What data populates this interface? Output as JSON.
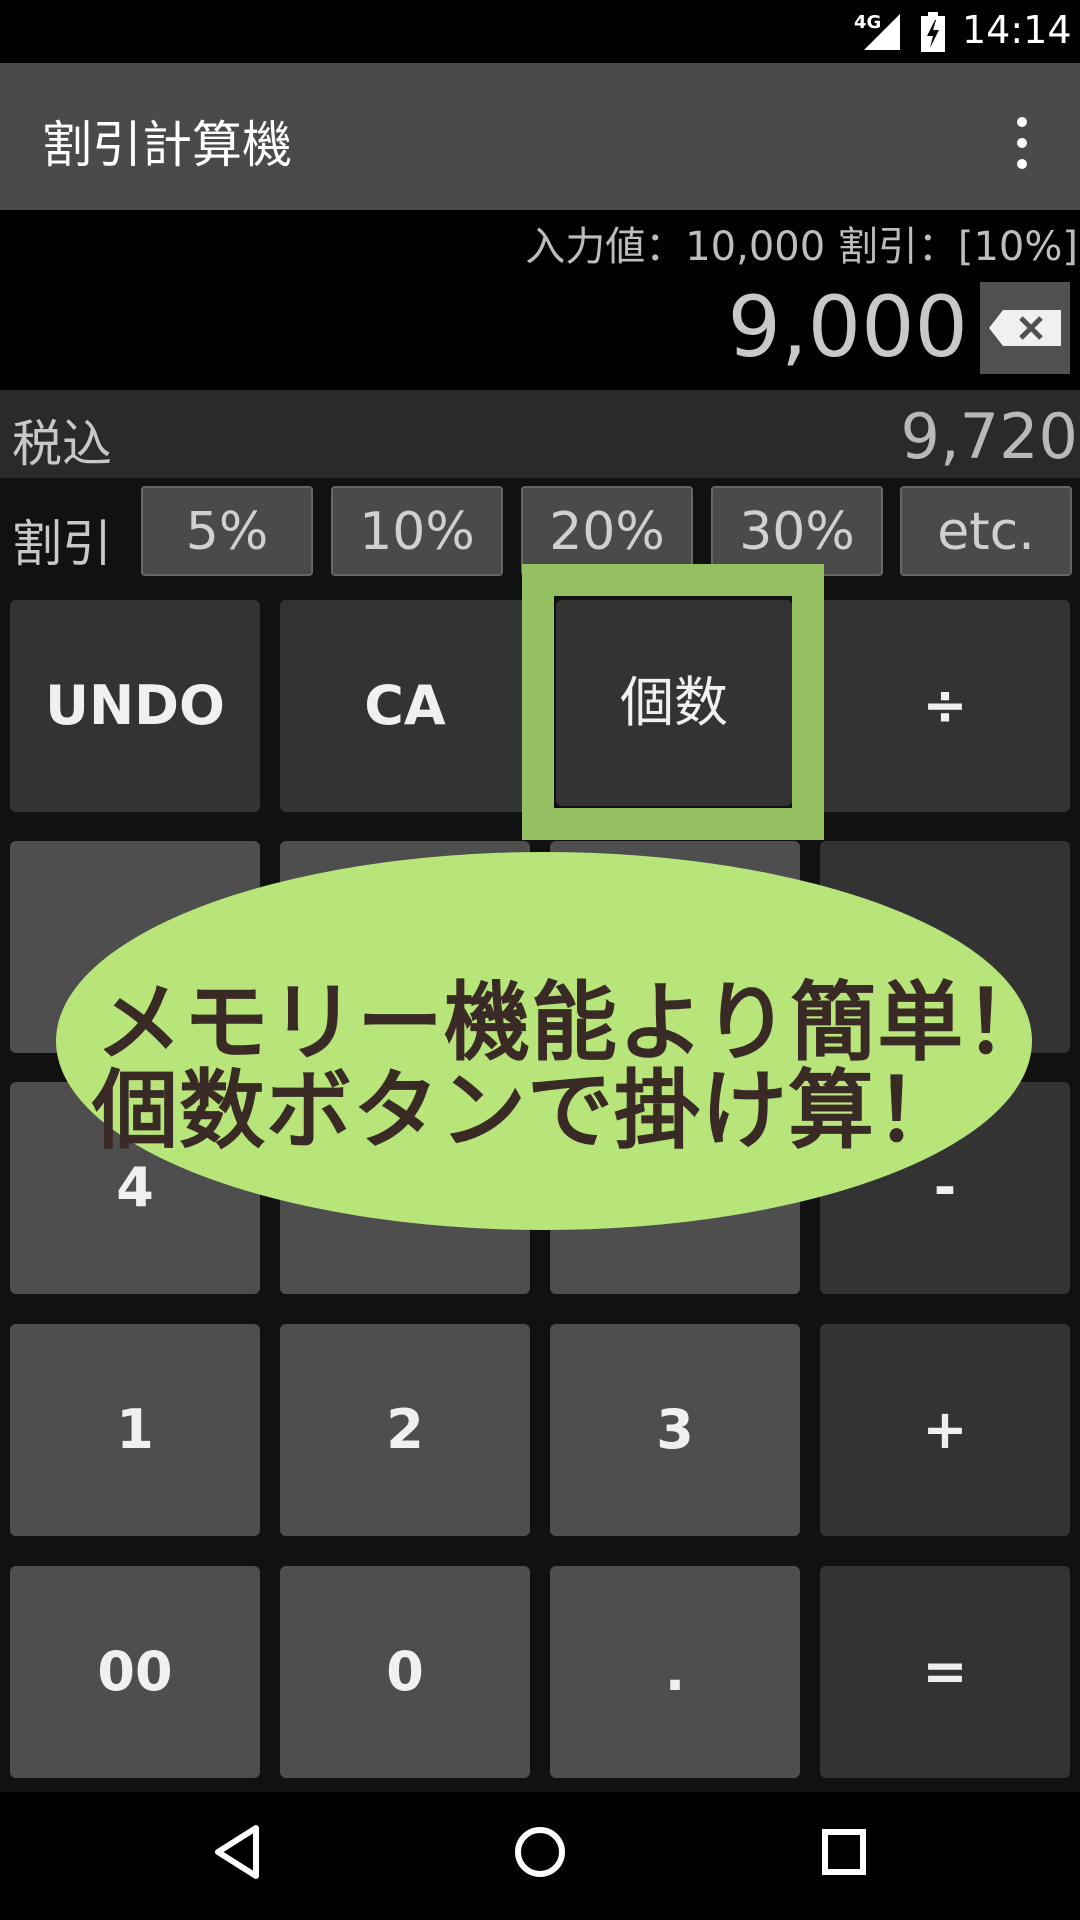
{
  "status_bar": {
    "network": "4G",
    "time": "14:14"
  },
  "app_bar": {
    "title": "割引計算機"
  },
  "display": {
    "info": "入力値：10,000  割引：[10%]",
    "value": "9,000"
  },
  "tax": {
    "label": "税込",
    "value": "9,720"
  },
  "discount": {
    "label": "割引",
    "buttons": [
      "5%",
      "10%",
      "20%",
      "30%",
      "etc."
    ]
  },
  "keys": {
    "undo": "UNDO",
    "ca": "CA",
    "count": "個数",
    "divide": "÷",
    "four": "4",
    "minus": "-",
    "one": "1",
    "two": "2",
    "three": "3",
    "plus": "+",
    "double_zero": "00",
    "zero": "0",
    "dot": ".",
    "equals": "="
  },
  "promo": {
    "line1": "メモリー機能より簡単！",
    "line2": "個数ボタンで掛け算！"
  },
  "colors": {
    "highlight": "#94c062",
    "promo_bg": "#b7e57a",
    "promo_text": "#3a2a26"
  },
  "icons": [
    "signal-icon",
    "battery-icon",
    "overflow-menu-icon",
    "backspace-icon",
    "back-nav-icon",
    "home-nav-icon",
    "recents-nav-icon"
  ]
}
